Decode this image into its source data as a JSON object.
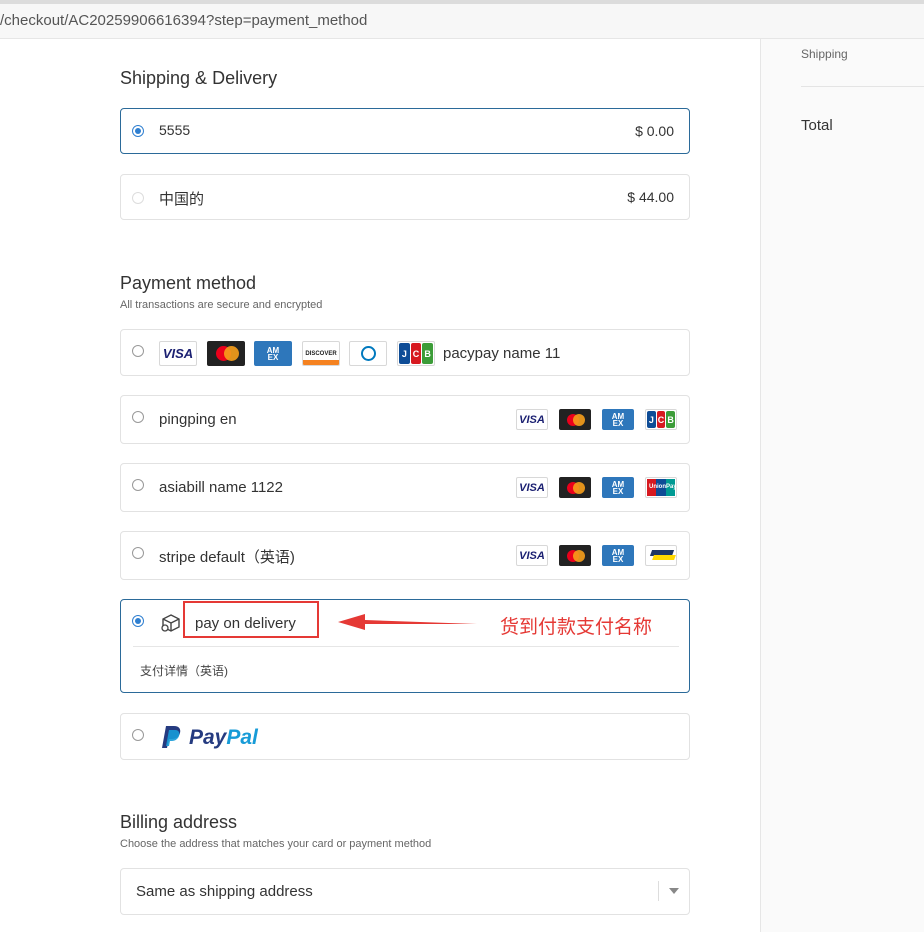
{
  "browser": {
    "url": "/checkout/AC20259906616394?step=payment_method"
  },
  "sidebar": {
    "shipping_label": "Shipping",
    "total_label": "Total"
  },
  "shipping": {
    "title": "Shipping & Delivery",
    "options": [
      {
        "name": "5555",
        "price": "$ 0.00",
        "selected": true
      },
      {
        "name": "中国的",
        "price": "$ 44.00",
        "selected": false
      }
    ]
  },
  "payment": {
    "title": "Payment method",
    "subtitle": "All transactions are secure and encrypted",
    "methods": [
      {
        "name": "pacypay name 11",
        "cards": [
          "visa-icon",
          "mastercard-icon",
          "amex-icon",
          "discover-icon",
          "diners-icon",
          "jcb-icon"
        ]
      },
      {
        "name": "pingping en",
        "cards": [
          "visa-icon",
          "mastercard-icon",
          "amex-icon",
          "jcb-icon"
        ]
      },
      {
        "name": "asiabill name 1122",
        "cards": [
          "visa-icon",
          "mastercard-icon",
          "amex-icon",
          "unionpay-icon"
        ]
      },
      {
        "name": "stripe default（英语)",
        "cards": [
          "visa-icon",
          "mastercard-icon",
          "amex-icon",
          "bancontact-icon"
        ]
      },
      {
        "name": "pay on delivery",
        "icon": "package-icon",
        "details": "支付详情（英语)",
        "selected": true
      },
      {
        "name": "PayPal",
        "pay": "Pay",
        "pal": "Pal",
        "icon": "paypal-icon"
      }
    ],
    "card_text": {
      "visa": "VISA",
      "amex_line1": "AM",
      "amex_line2": "EX",
      "discover": "DISCOVER",
      "jcb": [
        "J",
        "C",
        "B"
      ],
      "unionpay": "UnionPay"
    }
  },
  "annotation": {
    "text": "货到付款支付名称"
  },
  "billing": {
    "title": "Billing address",
    "subtitle": "Choose the address that matches your card or payment method",
    "selected_value": "Same as shipping address"
  },
  "colors": {
    "accent": "#2f7fd0",
    "selected_border": "#2b6a99",
    "annotation_red": "#e53935",
    "paypal_dark": "#253b80",
    "paypal_light": "#179bd7"
  }
}
